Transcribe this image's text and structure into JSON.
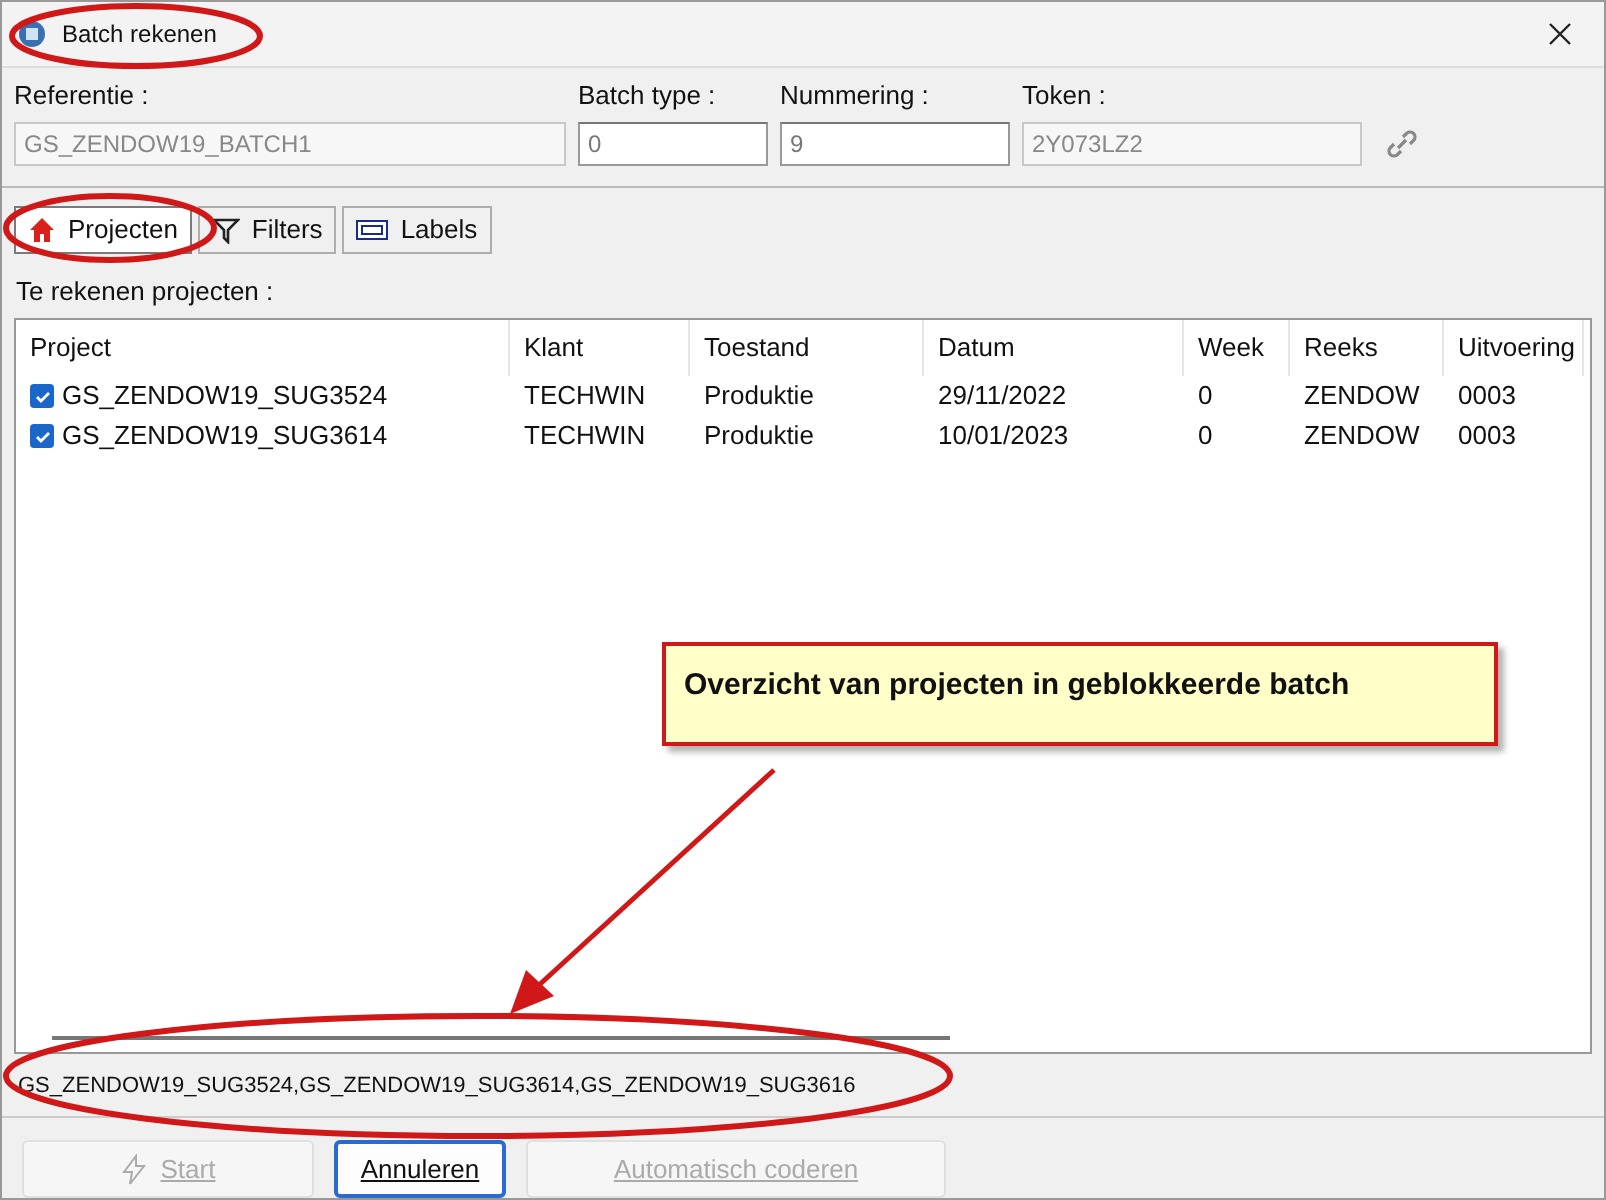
{
  "window": {
    "title": "Batch rekenen"
  },
  "fields": [
    {
      "label": "Referentie :",
      "value": "GS_ZENDOW19_BATCH1",
      "disabled": true
    },
    {
      "label": "Batch type :",
      "value": "0",
      "disabled": false
    },
    {
      "label": "Nummering :",
      "value": "9",
      "disabled": false
    },
    {
      "label": "Token :",
      "value": "2Y073LZ2",
      "disabled": true
    }
  ],
  "tabs": [
    {
      "label": "Projecten",
      "kind": "home",
      "selected": true
    },
    {
      "label": "Filters",
      "kind": "filter",
      "selected": false
    },
    {
      "label": "Labels",
      "kind": "label",
      "selected": false
    }
  ],
  "list_label": "Te rekenen projecten :",
  "table": {
    "columns": [
      "Project",
      "Klant",
      "Toestand",
      "Datum",
      "Week",
      "Reeks",
      "Uitvoering"
    ],
    "rows": [
      {
        "checked": true,
        "cells": [
          "GS_ZENDOW19_SUG3524",
          "TECHWIN",
          "Produktie",
          "29/11/2022",
          "0",
          "ZENDOW",
          "0003"
        ]
      },
      {
        "checked": true,
        "cells": [
          "GS_ZENDOW19_SUG3614",
          "TECHWIN",
          "Produktie",
          "10/01/2023",
          "0",
          "ZENDOW",
          "0003"
        ]
      }
    ]
  },
  "status_bar": "GS_ZENDOW19_SUG3524,GS_ZENDOW19_SUG3614,GS_ZENDOW19_SUG3616",
  "buttons": [
    {
      "label": "Start",
      "kind": "start",
      "disabled": true,
      "focused": false
    },
    {
      "label": "Annuleren",
      "kind": "plain",
      "disabled": false,
      "focused": true
    },
    {
      "label": "Automatisch coderen",
      "kind": "plain",
      "disabled": true,
      "focused": false
    }
  ],
  "callout": "Overzicht van projecten in geblokkeerde batch"
}
